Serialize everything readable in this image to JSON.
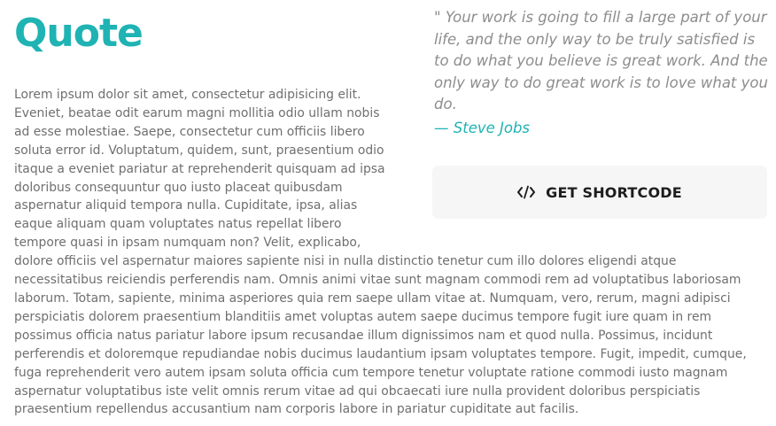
{
  "section": {
    "title": "Quote",
    "body": "Lorem ipsum dolor sit amet, consectetur adipisicing elit. Eveniet, beatae odit earum magni mollitia odio ullam nobis ad esse molestiae. Saepe, consectetur cum officiis libero soluta error id. Voluptatum, quidem, sunt, praesentium odio itaque a eveniet pariatur at reprehenderit quisquam ad ipsa doloribus consequuntur quo iusto placeat quibusdam aspernatur aliquid tempora nulla. Cupiditate, ipsa, alias eaque aliquam quam voluptates natus repellat libero tempore quasi in ipsam numquam non? Velit, explicabo, dolore officiis vel aspernatur maiores sapiente nisi in nulla distinctio tenetur cum illo dolores eligendi atque necessitatibus reiciendis perferendis nam. Omnis animi vitae sunt magnam commodi rem ad voluptatibus laboriosam laborum. Totam, sapiente, minima asperiores quia rem saepe ullam vitae at. Numquam, vero, rerum, magni adipisci perspiciatis dolorem praesentium blanditiis amet voluptas autem saepe ducimus tempore fugit iure quam in rem possimus officia natus pariatur labore ipsum recusandae illum dignissimos nam et quod nulla. Possimus, incidunt perferendis et doloremque repudiandae nobis ducimus laudantium ipsam voluptates tempore. Fugit, impedit, cumque, fuga reprehenderit vero autem ipsam soluta officia cum tempore tenetur voluptate ratione commodi iusto magnam aspernatur voluptatibus iste velit omnis rerum vitae ad qui obcaecati iure nulla provident doloribus perspiciatis praesentium repellendus accusantium nam corporis labore in pariatur cupiditate aut facilis."
  },
  "quote": {
    "text": "\" Your work is going to fill a large part of your life, and the only way to be truly satisfied is to do what you believe is great work. And the only way to do great work is to love what you do.",
    "author": "— Steve Jobs"
  },
  "shortcode_button": {
    "label": "GET SHORTCODE",
    "icon": "code-icon"
  },
  "colors": {
    "accent": "#1fb3b3",
    "quote_text": "#8d8d8d",
    "body_text": "#6f6f6f",
    "button_bg": "#f6f6f6",
    "button_text": "#1d1d1d"
  }
}
